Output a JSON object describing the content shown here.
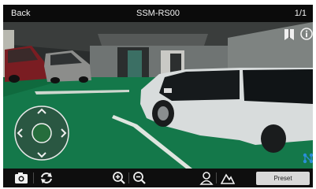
{
  "header": {
    "back_label": "Back",
    "title": "SSM-RS00",
    "page_counter": "1/1"
  },
  "overlay": {
    "bookmark_icon": "bookmark-icon",
    "info_icon": "info-icon",
    "ptz_icon": "ptz-joystick-icon",
    "connect_icon": "connection-icon"
  },
  "toolbar": {
    "icons": [
      "camera-snapshot-icon",
      "rotate-icon",
      "zoom-in-icon",
      "zoom-out-icon",
      "user-icon",
      "mountain-icon"
    ],
    "preset_label": "Preset"
  },
  "colors": {
    "bar_bg": "#0b0b0b",
    "floor_green": "#0f6a3e",
    "accent_blue": "#2a8fd8"
  }
}
